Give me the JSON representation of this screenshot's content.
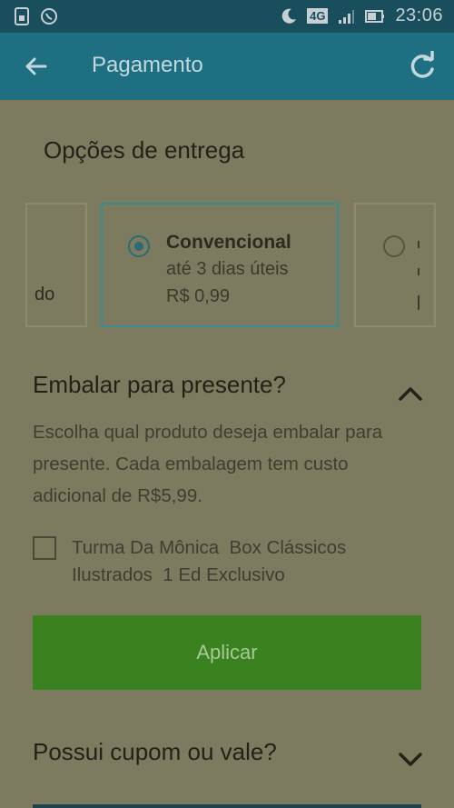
{
  "status_bar": {
    "time": "23:06",
    "network": "4G",
    "icons": [
      "sim-icon",
      "whatsapp-icon",
      "moon-icon",
      "signal-icon",
      "battery-icon"
    ]
  },
  "app_bar": {
    "title": "Pagamento",
    "back_icon": "arrow-left-icon",
    "refresh_icon": "refresh-icon"
  },
  "delivery": {
    "title": "Opções de entrega",
    "options": [
      {
        "partial_text": "do"
      },
      {
        "name": "Convencional",
        "time": "até 3 dias úteis",
        "price": "R$ 0,99",
        "selected": true
      },
      {
        "selected": false
      }
    ]
  },
  "gift": {
    "title": "Embalar para presente?",
    "description": "Escolha qual produto deseja embalar para presente. Cada embalagem tem custo adicional de R$5,99.",
    "product": "Turma Da Mônica  Box Clássicos\nIlustrados  1 Ed Exclusivo",
    "product_checked": false,
    "apply_label": "Aplicar"
  },
  "coupon": {
    "title": "Possui cupom ou vale?"
  },
  "colors": {
    "app_bar": "#1f6f83",
    "status_bar": "#194f5d",
    "background": "#7d7b5f",
    "accent": "#3c8b90",
    "apply_button": "#3a821f"
  }
}
